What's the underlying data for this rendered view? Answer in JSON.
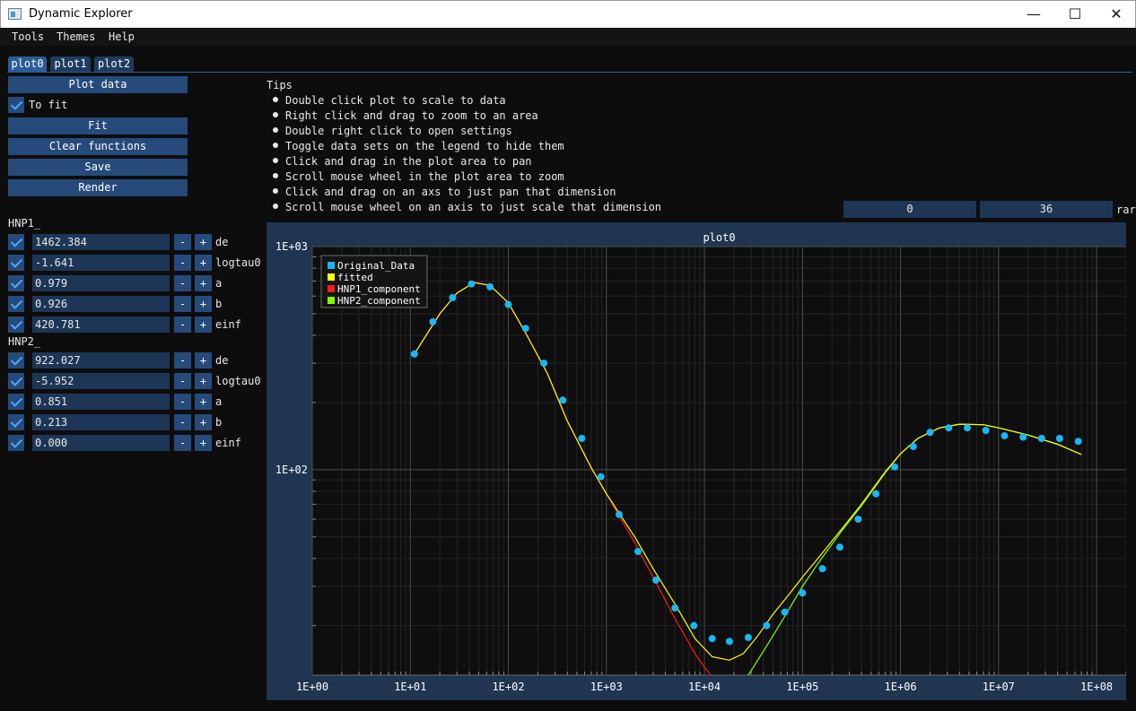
{
  "window": {
    "title": "Dynamic Explorer",
    "min_symbol": "—",
    "max_symbol": "☐",
    "close_symbol": "✕"
  },
  "menu": [
    "Tools",
    "Themes",
    "Help"
  ],
  "tabs": [
    "plot0",
    "plot1",
    "plot2"
  ],
  "actions": {
    "plot_data": "Plot data",
    "to_fit": "To fit",
    "fit": "Fit",
    "clear_functions": "Clear functions",
    "save": "Save",
    "render": "Render"
  },
  "groups": [
    {
      "name": "HNP1_",
      "params": [
        {
          "value": "1462.384",
          "name": "de"
        },
        {
          "value": "-1.641",
          "name": "logtau0"
        },
        {
          "value": "0.979",
          "name": "a"
        },
        {
          "value": "0.926",
          "name": "b"
        },
        {
          "value": "420.781",
          "name": "einf"
        }
      ]
    },
    {
      "name": "HNP2_",
      "params": [
        {
          "value": "922.027",
          "name": "de"
        },
        {
          "value": "-5.952",
          "name": "logtau0"
        },
        {
          "value": "0.851",
          "name": "a"
        },
        {
          "value": "0.213",
          "name": "b"
        },
        {
          "value": "0.000",
          "name": "einf"
        }
      ]
    }
  ],
  "stepper": {
    "minus": "-",
    "plus": "+"
  },
  "tips": {
    "title": "Tips",
    "items": [
      "Double click plot to scale to data",
      "Right click and drag to zoom to an area",
      "Double right click to open settings",
      "Toggle data sets on the legend to hide them",
      "Click and drag in the plot area to pan",
      "Scroll mouse wheel in the plot area to zoom",
      "Click and drag on an axs to just pan that dimension",
      "Scroll mouse wheel on an axis to just scale that dimension"
    ]
  },
  "range": {
    "start": "0",
    "end": "36",
    "label": "rar"
  },
  "colors": {
    "accent": "#264a7a",
    "original": "#17b8f5",
    "fitted": "#ffff00",
    "hnp1": "#ff1a1a",
    "hnp2": "#80ff00"
  },
  "chart_data": {
    "type": "scatter",
    "title": "plot0",
    "x_scale": "log",
    "y_scale": "log",
    "xlim": [
      1,
      200000000
    ],
    "ylim": [
      12,
      1000
    ],
    "x_ticks": [
      "1E+00",
      "1E+01",
      "1E+02",
      "1E+03",
      "1E+04",
      "1E+05",
      "1E+06",
      "1E+07",
      "1E+08"
    ],
    "y_ticks": [
      "1E+02",
      "1E+03"
    ],
    "grid": true,
    "legend_position": "top-left",
    "series": [
      {
        "name": "Original_Data",
        "kind": "points",
        "x": [
          11,
          17,
          27,
          42,
          65,
          100,
          150,
          230,
          360,
          560,
          880,
          1350,
          2100,
          3200,
          5000,
          7800,
          12000,
          18000,
          28000,
          43000,
          66000,
          100000,
          160000,
          240000,
          370000,
          560000,
          870000,
          1350000,
          2000000,
          3100000,
          4800000,
          7400000,
          11500000,
          17800000,
          27500000,
          42000000,
          65000000
        ],
        "y": [
          330,
          460,
          590,
          680,
          660,
          550,
          430,
          300,
          205,
          138,
          93,
          63,
          43,
          32,
          24,
          20,
          17.5,
          17,
          17.7,
          20,
          23,
          28,
          36,
          45,
          60,
          78,
          103,
          127,
          147,
          154,
          154,
          150,
          142,
          140,
          138,
          138,
          134
        ]
      },
      {
        "name": "fitted",
        "kind": "line",
        "x": [
          11,
          20,
          30,
          45,
          65,
          100,
          150,
          250,
          400,
          700,
          1000,
          2000,
          3000,
          5000,
          8000,
          12000,
          18000,
          25000,
          35000,
          50000,
          70000,
          100000,
          150000,
          250000,
          400000,
          700000,
          1000000,
          1500000,
          2500000,
          4000000,
          7000000,
          10000000,
          20000000,
          40000000,
          70000000
        ],
        "y": [
          330,
          500,
          620,
          690,
          670,
          560,
          410,
          270,
          165,
          102,
          78,
          49,
          36,
          25,
          17.5,
          14.5,
          14,
          15,
          18,
          22.5,
          27,
          33,
          41,
          54,
          70,
          98,
          118,
          138,
          154,
          160,
          159,
          154,
          143,
          130,
          117
        ]
      },
      {
        "name": "HNP1_component",
        "kind": "line",
        "x": [
          11,
          20,
          30,
          45,
          65,
          100,
          150,
          250,
          400,
          700,
          1000,
          2000,
          3000,
          5000,
          8000,
          10000,
          12000
        ],
        "y": [
          330,
          500,
          620,
          690,
          670,
          560,
          410,
          270,
          165,
          102,
          78,
          46,
          33,
          21.5,
          15,
          13,
          11.8
        ]
      },
      {
        "name": "HNP2_component",
        "kind": "line",
        "x": [
          28000,
          35000,
          50000,
          70000,
          100000,
          150000,
          250000,
          400000,
          700000,
          1000000,
          1500000,
          2500000,
          4000000,
          7000000,
          10000000,
          20000000,
          40000000,
          70000000
        ],
        "y": [
          12,
          14,
          18,
          23,
          30,
          39,
          53,
          69,
          97,
          118,
          138,
          154,
          160,
          159,
          154,
          143,
          130,
          117
        ]
      }
    ]
  }
}
